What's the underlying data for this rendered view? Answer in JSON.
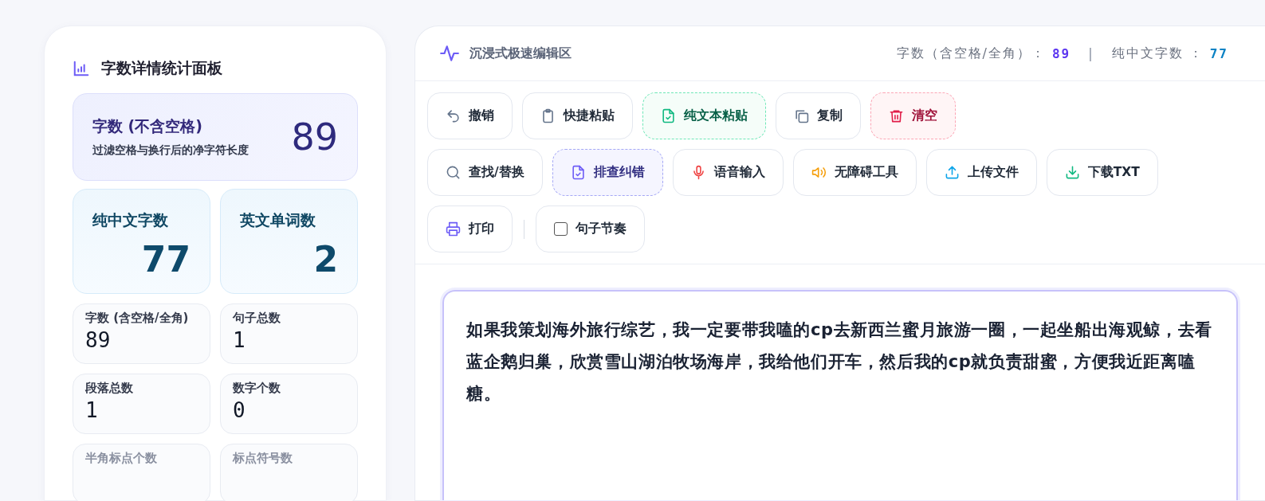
{
  "stats_panel": {
    "title": "字数详情统计面板",
    "headline": {
      "label": "字数 (不含空格)",
      "caption": "过滤空格与换行后的净字符长度",
      "value": "89"
    },
    "highlights": [
      {
        "label": "纯中文字数",
        "value": "77"
      },
      {
        "label": "英文单词数",
        "value": "2"
      }
    ],
    "cards": [
      {
        "label": "字数 (含空格/全角)",
        "value": "89"
      },
      {
        "label": "句子总数",
        "value": "1"
      },
      {
        "label": "段落总数",
        "value": "1"
      },
      {
        "label": "数字个数",
        "value": "0"
      },
      {
        "label": "半角标点个数"
      },
      {
        "label": "标点符号数"
      }
    ]
  },
  "editor": {
    "title": "沉浸式极速编辑区",
    "counters": [
      {
        "label": "字数（含空格/全角）：",
        "value": "89"
      },
      {
        "label": "纯中文字数 ：",
        "value": "77"
      }
    ],
    "separator": "|",
    "toolbar": [
      [
        {
          "label": "撤销",
          "kind": "plain"
        },
        {
          "label": "快捷粘贴",
          "kind": "plain"
        },
        {
          "label": "纯文本粘贴",
          "kind": "success"
        },
        {
          "label": "复制",
          "kind": "plain"
        },
        {
          "label": "清空",
          "kind": "danger"
        }
      ],
      [
        {
          "label": "查找/替换",
          "kind": "plain"
        },
        {
          "label": "排查纠错",
          "kind": "primary"
        },
        {
          "label": "语音输入",
          "kind": "plain"
        },
        {
          "label": "无障碍工具",
          "kind": "plain"
        },
        {
          "label": "上传文件",
          "kind": "plain"
        },
        {
          "label": "下载TXT",
          "kind": "plain"
        }
      ],
      [
        {
          "label": "打印",
          "kind": "plain"
        },
        {
          "label": "句子节奏",
          "kind": "toggle",
          "checked": false
        }
      ]
    ],
    "text": "如果我策划海外旅行综艺，我一定要带我嗑的cp去新西兰蜜月旅游一圈，一起坐船出海观鲸，去看蓝企鹅归巢，欣赏雪山湖泊牧场海岸，我给他们开车，然后我的cp就负责甜蜜，方便我近距离嗑糖。"
  }
}
